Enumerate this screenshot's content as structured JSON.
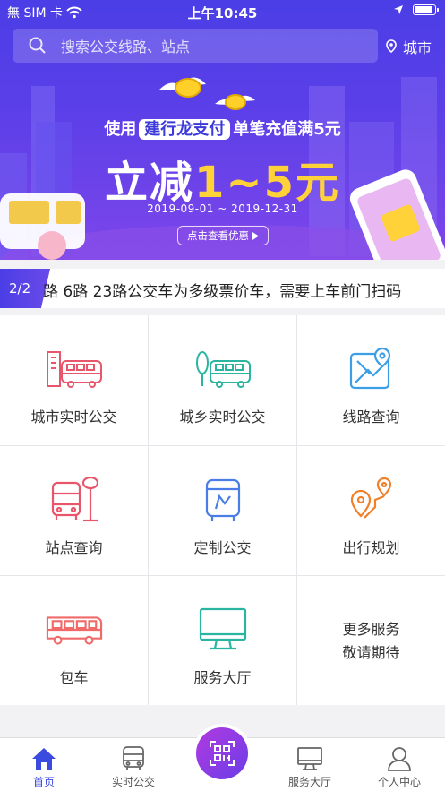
{
  "status_bar": {
    "carrier": "無 SIM 卡",
    "time": "上午10:45"
  },
  "search": {
    "placeholder": "搜索公交线路、站点",
    "city_label": "城市"
  },
  "banner": {
    "line1_pre": "使用",
    "line1_highlight": "建行龙支付",
    "line1_post": "单笔充值满5元",
    "line2_pre": "立减",
    "line2_amount": "1~5元",
    "dates": "2019-09-01 ~ 2019-12-31",
    "cta": "点击查看优惠"
  },
  "notice": {
    "page": "2/2",
    "text": "路 6路 23路公交车为多级票价车，需要上车前门扫码"
  },
  "services": [
    {
      "label": "城市实时公交",
      "icon": "city-bus-icon",
      "color": "#e8566b"
    },
    {
      "label": "城乡实时公交",
      "icon": "rural-bus-icon",
      "color": "#2bb5a0"
    },
    {
      "label": "线路查询",
      "icon": "map-route-icon",
      "color": "#3b9ee6"
    },
    {
      "label": "站点查询",
      "icon": "bus-stop-icon",
      "color": "#e8566b"
    },
    {
      "label": "定制公交",
      "icon": "custom-bus-icon",
      "color": "#4a7ee6"
    },
    {
      "label": "出行规划",
      "icon": "trip-plan-icon",
      "color": "#f0802a"
    },
    {
      "label": "包车",
      "icon": "charter-bus-icon",
      "color": "#f06a6a"
    },
    {
      "label": "服务大厅",
      "icon": "monitor-icon",
      "color": "#2bb5a0"
    },
    {
      "label": "更多服务\n敬请期待",
      "icon": "",
      "color": "#333333"
    }
  ],
  "tabs": [
    {
      "label": "首页",
      "icon": "home-icon",
      "active": true
    },
    {
      "label": "实时公交",
      "icon": "bus-icon",
      "active": false
    },
    {
      "label": "",
      "icon": "scan-code-icon",
      "active": false
    },
    {
      "label": "服务大厅",
      "icon": "monitor-icon",
      "active": false
    },
    {
      "label": "个人中心",
      "icon": "user-icon",
      "active": false
    }
  ],
  "colors": {
    "primary": "#4b3ee6",
    "accent_yellow": "#ffd23a",
    "tab_active": "#3b4be0"
  }
}
